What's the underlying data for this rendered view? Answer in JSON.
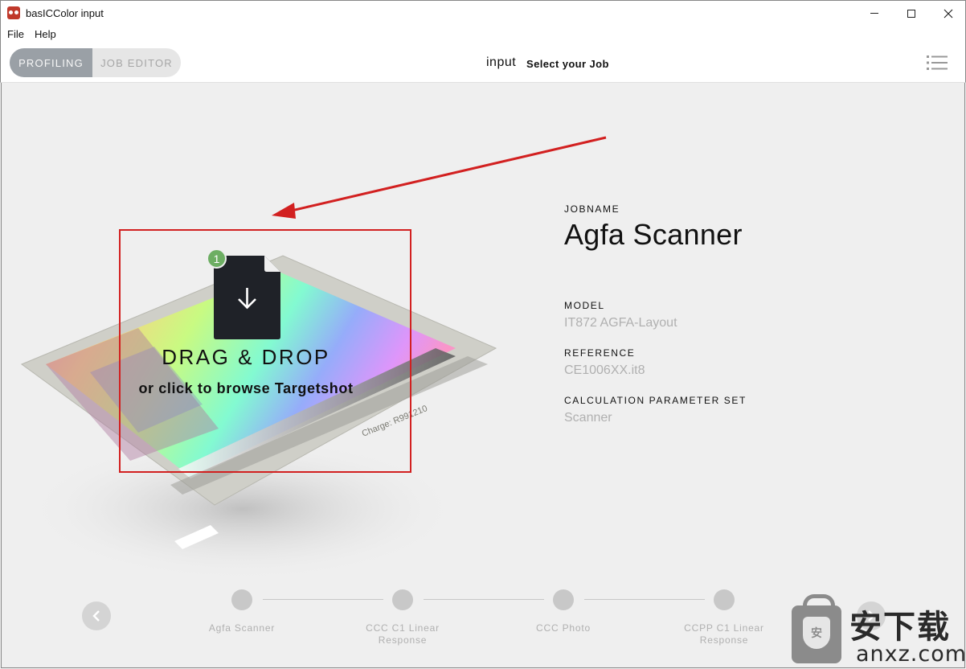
{
  "window": {
    "title": "basICColor input"
  },
  "menubar": {
    "items": [
      "File",
      "Help"
    ]
  },
  "toolbar": {
    "segment": {
      "active": "PROFILING",
      "inactive": "JOB EDITOR"
    },
    "brand": "input",
    "step_title": "Select your Job",
    "menu_icon": "list-menu-icon"
  },
  "dropzone": {
    "badge": "1",
    "title": "DRAG & DROP",
    "subtitle": "or click to browse Targetshot",
    "highlight_color": "#d22020",
    "target_label": "Charge: R991210"
  },
  "job": {
    "jobname_label": "JOBNAME",
    "jobname": "Agfa Scanner",
    "model_label": "MODEL",
    "model": "IT872 AGFA-Layout",
    "reference_label": "REFERENCE",
    "reference": "CE1006XX.it8",
    "param_label": "CALCULATION PARAMETER SET",
    "param": "Scanner"
  },
  "stepper": {
    "steps": [
      {
        "label": "Agfa Scanner"
      },
      {
        "label": "CCC C1 Linear Response"
      },
      {
        "label": "CCC Photo"
      },
      {
        "label": "CCPP C1 Linear Response"
      }
    ]
  },
  "watermark": {
    "cn": "安下载",
    "url": "anxz.com",
    "shield": "安"
  },
  "colors": {
    "accent_red": "#d22020",
    "badge_green": "#6dae63",
    "segment_active": "#9aa0a6"
  }
}
